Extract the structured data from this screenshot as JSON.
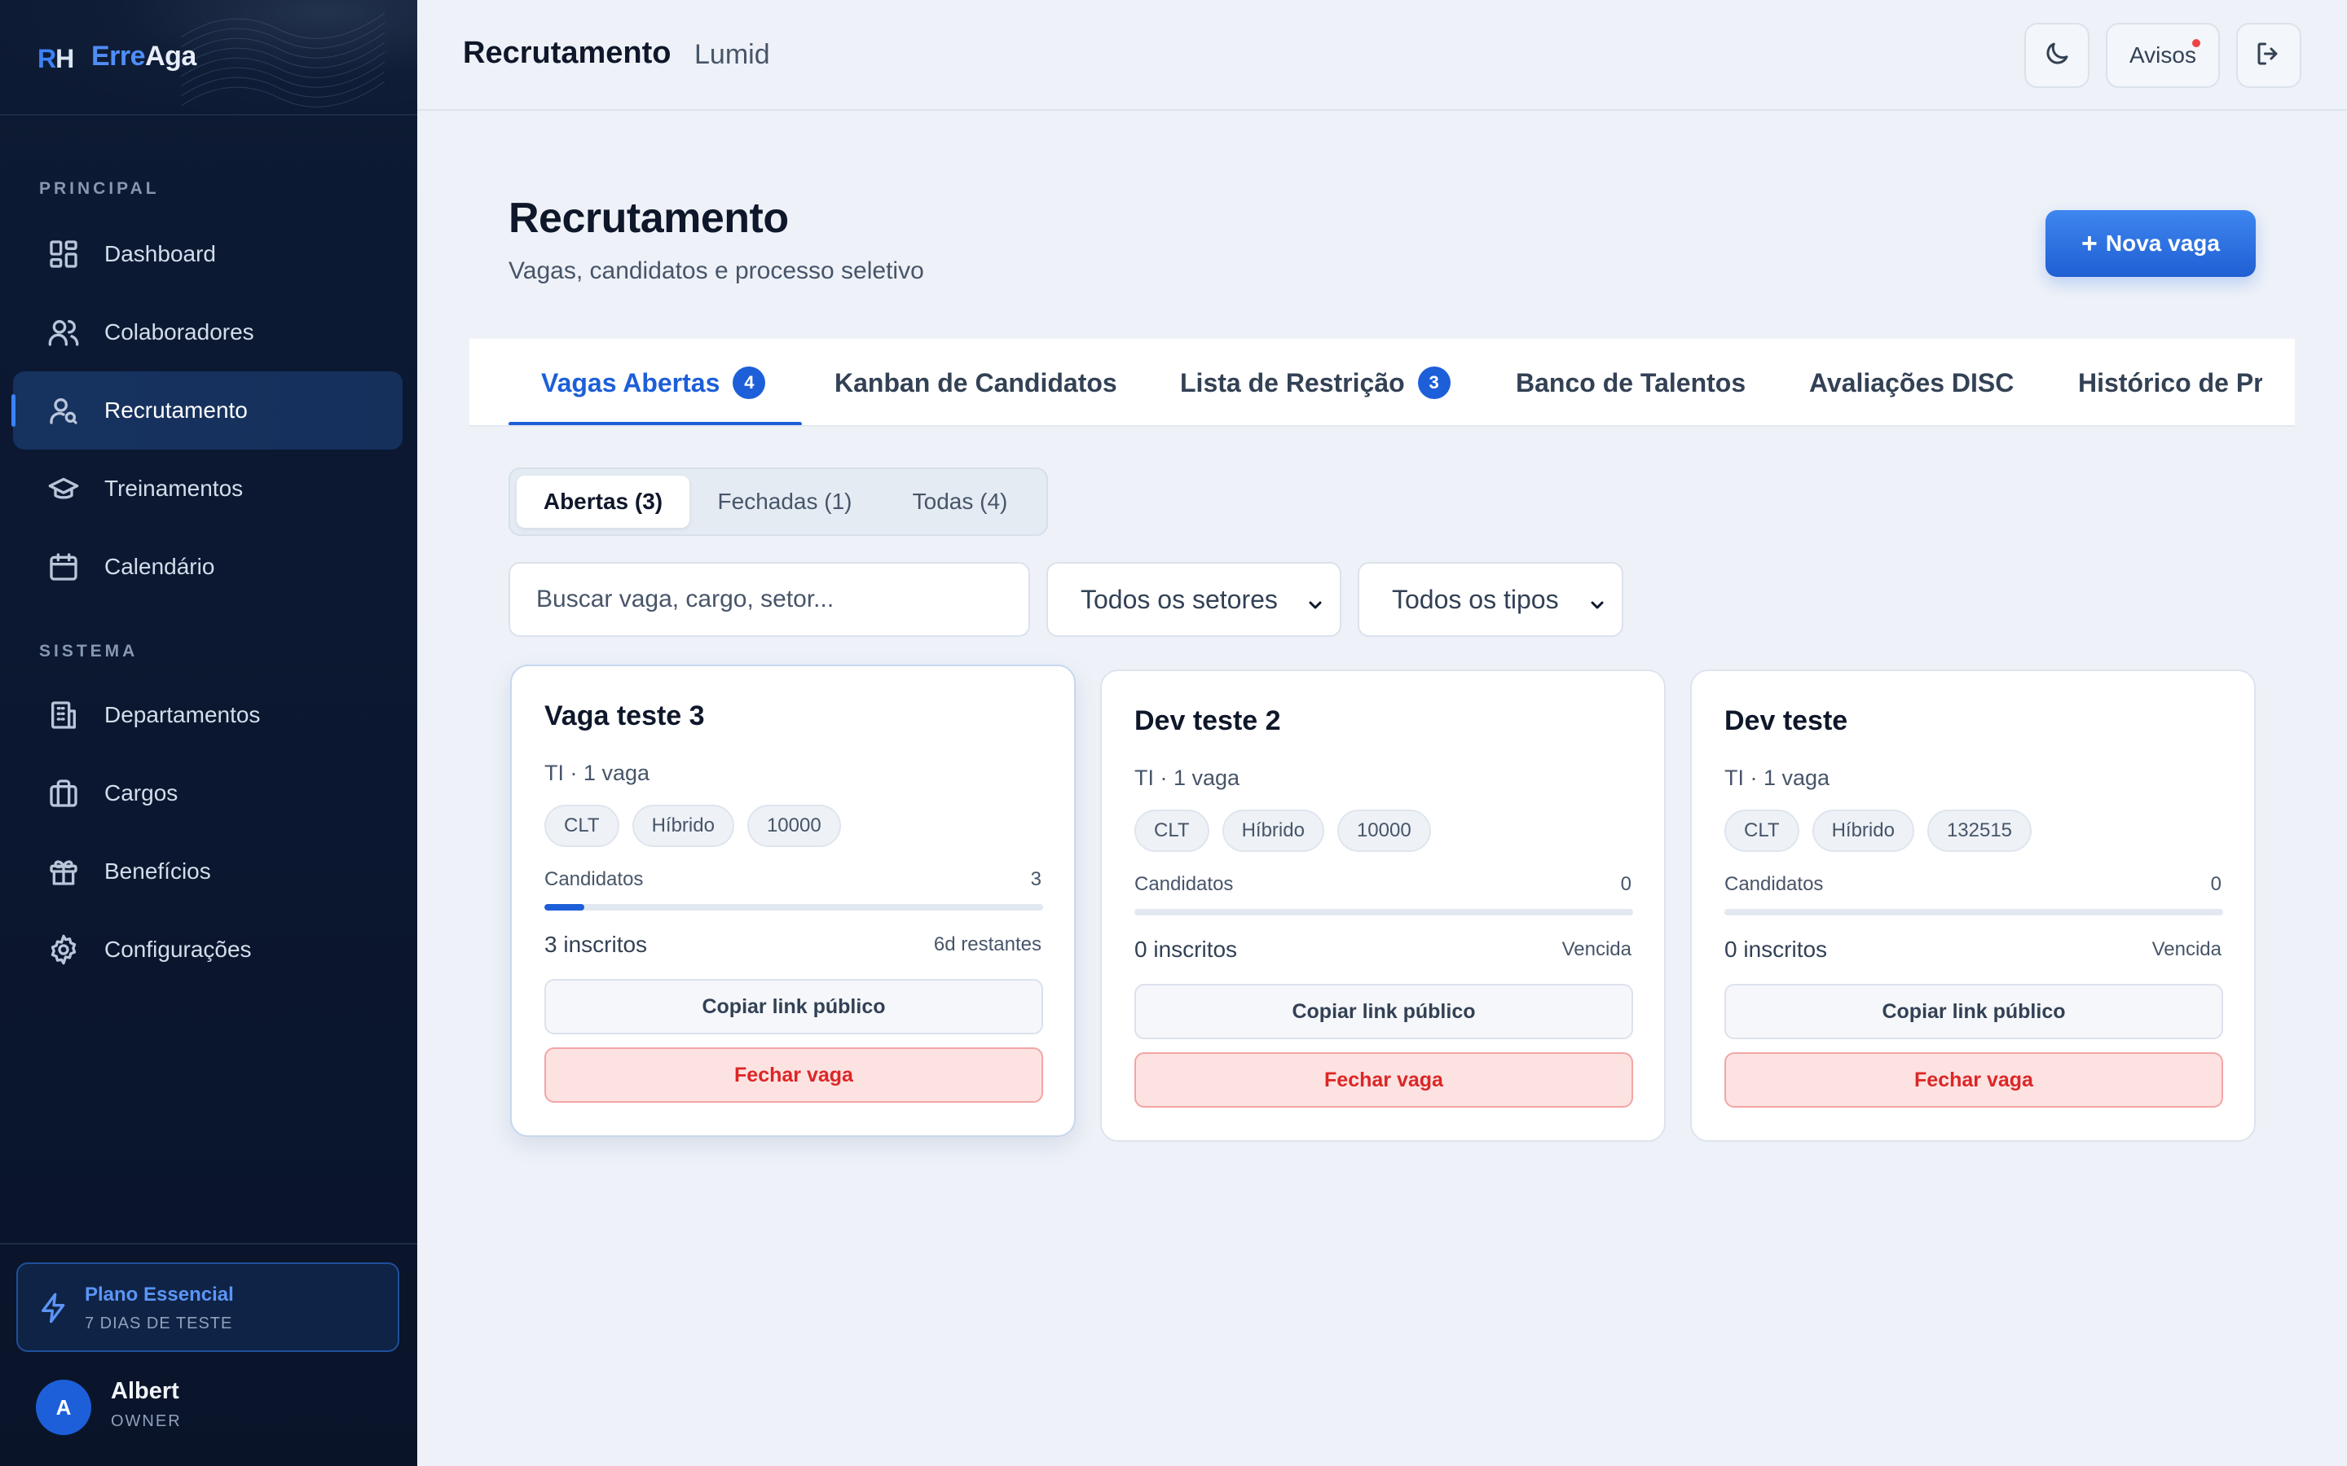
{
  "brand": {
    "mark_r": "R",
    "mark_h": "H",
    "name_part1": "Erre",
    "name_part2": "Aga"
  },
  "sidebar": {
    "section_principal": "PRINCIPAL",
    "section_sistema": "SISTEMA",
    "items": [
      {
        "label": "Dashboard",
        "icon": "dashboard-icon"
      },
      {
        "label": "Colaboradores",
        "icon": "users-icon"
      },
      {
        "label": "Recrutamento",
        "icon": "user-search-icon",
        "active": true
      },
      {
        "label": "Treinamentos",
        "icon": "graduation-cap-icon"
      },
      {
        "label": "Calendário",
        "icon": "calendar-icon"
      },
      {
        "label": "Departamentos",
        "icon": "building-icon"
      },
      {
        "label": "Cargos",
        "icon": "briefcase-icon"
      },
      {
        "label": "Benefícios",
        "icon": "gift-icon"
      },
      {
        "label": "Configurações",
        "icon": "settings-icon"
      }
    ],
    "plan": {
      "title": "Plano Essencial",
      "subtitle": "7 DIAS DE TESTE",
      "icon": "lightning-icon"
    },
    "user": {
      "initial": "A",
      "name": "Albert",
      "role": "OWNER"
    }
  },
  "header": {
    "title": "Recrutamento",
    "company": "Lumid",
    "notices_label": "Avisos",
    "icons": [
      "moon-icon",
      "logout-icon"
    ]
  },
  "main": {
    "title": "Recrutamento",
    "subtitle": "Vagas, candidatos e processo seletivo",
    "new_button": {
      "plus": "+",
      "label": "Nova vaga"
    },
    "tabs": [
      {
        "label": "Vagas Abertas",
        "badge": "4",
        "active": true
      },
      {
        "label": "Kanban de Candidatos"
      },
      {
        "label": "Lista de Restrição",
        "badge": "3"
      },
      {
        "label": "Banco de Talentos"
      },
      {
        "label": "Avaliações DISC"
      },
      {
        "label": "Histórico de Pr"
      }
    ],
    "segments": [
      {
        "label": "Abertas (3)",
        "active": true
      },
      {
        "label": "Fechadas (1)"
      },
      {
        "label": "Todas (4)"
      }
    ],
    "search_placeholder": "Buscar vaga, cargo, setor...",
    "filters": {
      "sector": "Todos os setores",
      "type": "Todos os tipos"
    },
    "cards": [
      {
        "title": "Vaga teste 3",
        "meta": "TI · 1 vaga",
        "chips": [
          "CLT",
          "Híbrido",
          "10000"
        ],
        "candidates_label": "Candidatos",
        "candidates": "3",
        "progress": 0.08,
        "enrolled": "3 inscritos",
        "status": "6d restantes",
        "copy_label": "Copiar link público",
        "close_label": "Fechar vaga"
      },
      {
        "title": "Dev teste 2",
        "meta": "TI · 1 vaga",
        "chips": [
          "CLT",
          "Híbrido",
          "10000"
        ],
        "candidates_label": "Candidatos",
        "candidates": "0",
        "progress": 0,
        "enrolled": "0 inscritos",
        "status": "Vencida",
        "copy_label": "Copiar link público",
        "close_label": "Fechar vaga"
      },
      {
        "title": "Dev teste",
        "meta": "TI · 1 vaga",
        "chips": [
          "CLT",
          "Híbrido",
          "132515"
        ],
        "candidates_label": "Candidatos",
        "candidates": "0",
        "progress": 0,
        "enrolled": "0 inscritos",
        "status": "Vencida",
        "copy_label": "Copiar link público",
        "close_label": "Fechar vaga"
      }
    ]
  },
  "colors": {
    "accent": "#1d5fd8",
    "sidebar_bg": "#0d1a33",
    "danger": "#dc2626",
    "danger_bg": "#fde2e2"
  }
}
